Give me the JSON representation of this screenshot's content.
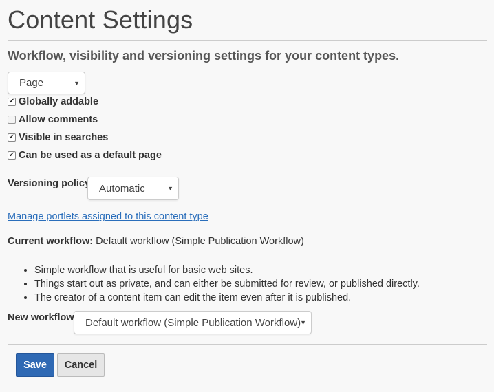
{
  "page": {
    "title": "Content Settings",
    "subtitle": "Workflow, visibility and versioning settings for your content types."
  },
  "content_type_select": {
    "value": "Page"
  },
  "options": {
    "globally_addable": {
      "label": "Globally addable",
      "checked": true
    },
    "allow_comments": {
      "label": "Allow comments",
      "checked": false
    },
    "visible_in_searches": {
      "label": "Visible in searches",
      "checked": true
    },
    "default_page": {
      "label": "Can be used as a default page",
      "checked": true
    }
  },
  "versioning": {
    "label": "Versioning policy:",
    "value": "Automatic"
  },
  "portlets_link": "Manage portlets assigned to this content type",
  "current_workflow": {
    "label": "Current workflow:",
    "value": "Default workflow (Simple Publication Workflow)"
  },
  "workflow_description": [
    "Simple workflow that is useful for basic web sites.",
    "Things start out as private, and can either be submitted for review, or published directly.",
    "The creator of a content item can edit the item even after it is published."
  ],
  "new_workflow": {
    "label": "New workflow:",
    "value": "Default workflow (Simple Publication Workflow)"
  },
  "buttons": {
    "save": "Save",
    "cancel": "Cancel"
  },
  "colors": {
    "primary": "#2f69b4",
    "link": "#2a6ebb",
    "background": "#f8f8f8"
  }
}
